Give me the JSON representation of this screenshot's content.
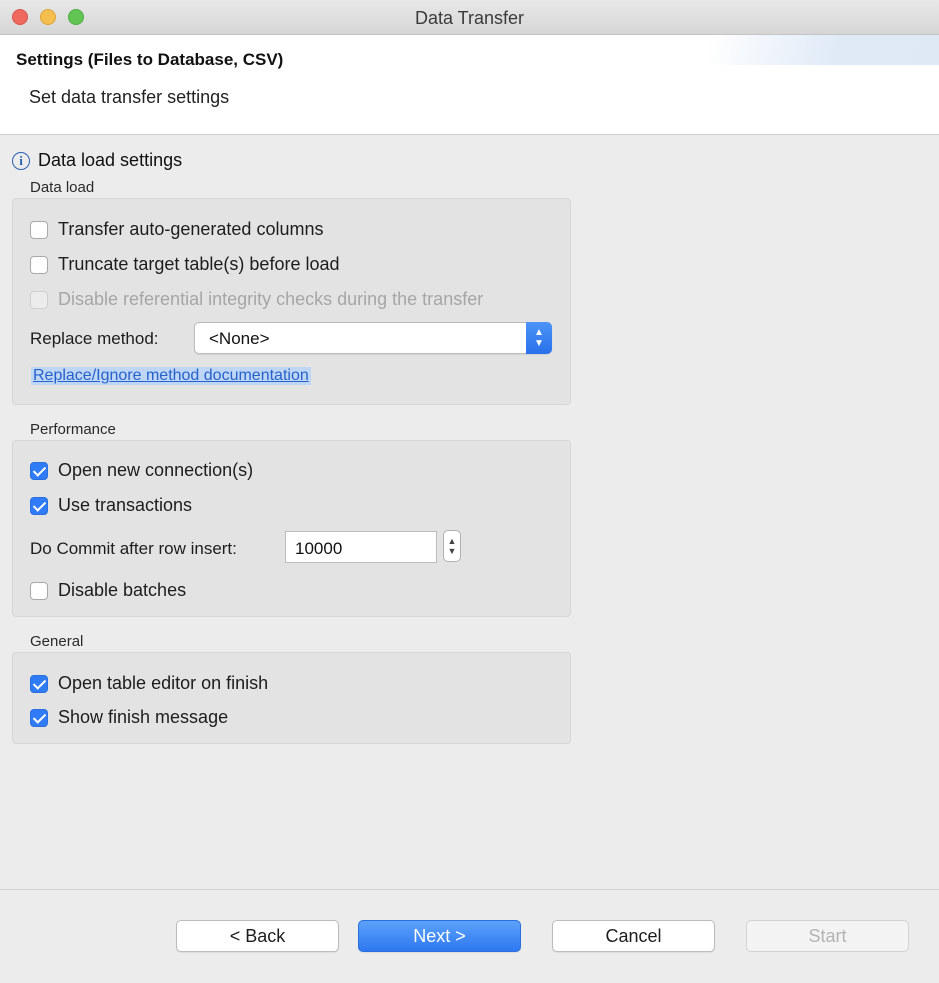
{
  "window": {
    "title": "Data Transfer"
  },
  "header": {
    "title": "Settings (Files to Database, CSV)",
    "subtitle": "Set data transfer settings"
  },
  "section": {
    "icon": "info-icon",
    "title": "Data load settings"
  },
  "data_load": {
    "label": "Data load",
    "transfer_auto_generated": {
      "label": "Transfer auto-generated columns",
      "checked": false
    },
    "truncate_target": {
      "label": "Truncate target table(s) before load",
      "checked": false
    },
    "disable_integrity": {
      "label": "Disable referential integrity checks during the transfer",
      "checked": false,
      "enabled": false
    },
    "replace_method": {
      "label": "Replace method:",
      "value": "<None>"
    },
    "doc_link": "Replace/Ignore method documentation"
  },
  "performance": {
    "label": "Performance",
    "open_new_connection": {
      "label": "Open new connection(s)",
      "checked": true
    },
    "use_transactions": {
      "label": "Use transactions",
      "checked": true
    },
    "commit_after": {
      "label": "Do Commit after row insert:",
      "value": "10000"
    },
    "disable_batches": {
      "label": "Disable batches",
      "checked": false
    }
  },
  "general": {
    "label": "General",
    "open_table_editor": {
      "label": "Open table editor on finish",
      "checked": true
    },
    "show_finish_message": {
      "label": "Show finish message",
      "checked": true
    }
  },
  "buttons": {
    "back": "< Back",
    "next": "Next >",
    "cancel": "Cancel",
    "start": "Start"
  },
  "colors": {
    "accent": "#2f7cf6",
    "link": "#2562c9"
  }
}
